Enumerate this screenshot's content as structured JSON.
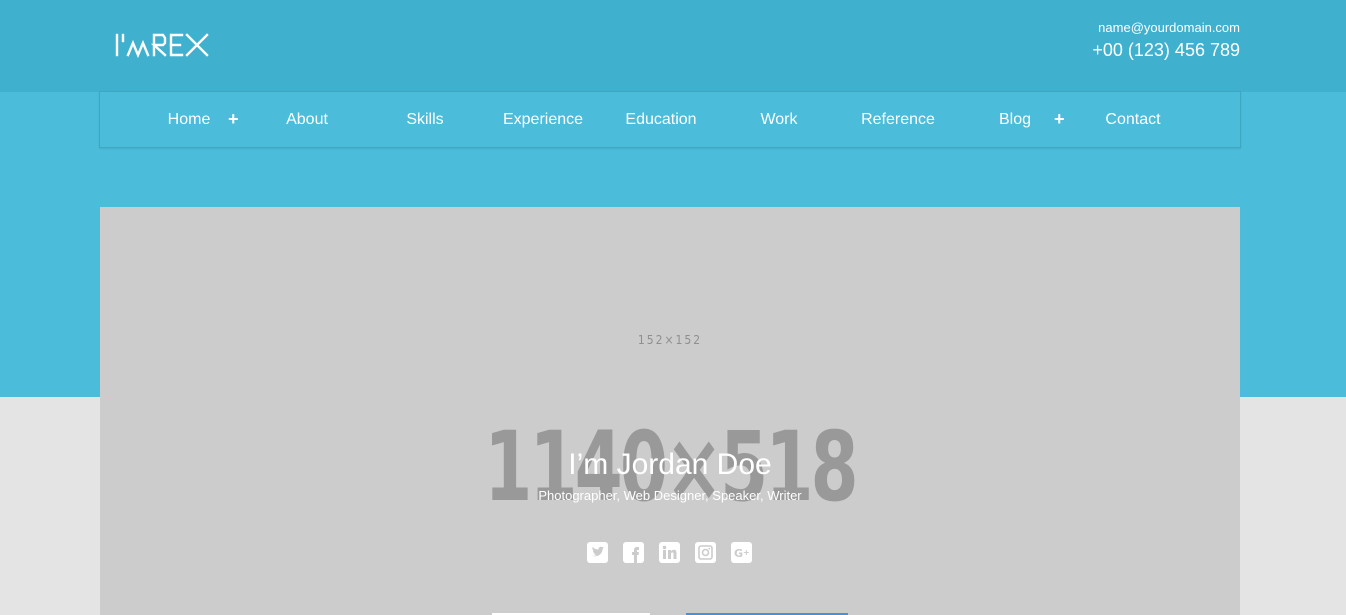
{
  "logo": {
    "text": "I'MREX"
  },
  "contact": {
    "email": "name@yourdomain.com",
    "phone": "+00 (123) 456 789"
  },
  "nav": {
    "items": [
      {
        "label": "Home",
        "has_submenu": true
      },
      {
        "label": "About"
      },
      {
        "label": "Skills"
      },
      {
        "label": "Experience"
      },
      {
        "label": "Education"
      },
      {
        "label": "Work"
      },
      {
        "label": "Reference"
      },
      {
        "label": "Blog",
        "has_submenu": true
      },
      {
        "label": "Contact"
      }
    ],
    "submenu_symbol": "+"
  },
  "hero": {
    "placeholder_small": "152×152",
    "placeholder_big": "1140×518",
    "title": "I’m Jordan Doe",
    "subtitle": "Photographer, Web Designer, Speaker, Writer"
  },
  "social": [
    {
      "icon": "twitter-icon"
    },
    {
      "icon": "facebook-icon"
    },
    {
      "icon": "linkedin-icon"
    },
    {
      "icon": "instagram-icon"
    },
    {
      "icon": "google-plus-icon"
    }
  ],
  "colors": {
    "header": "#40b0cf",
    "band": "#4bbcd9",
    "page_bg": "#e4e4e4",
    "hero_bg": "#cccccc"
  }
}
